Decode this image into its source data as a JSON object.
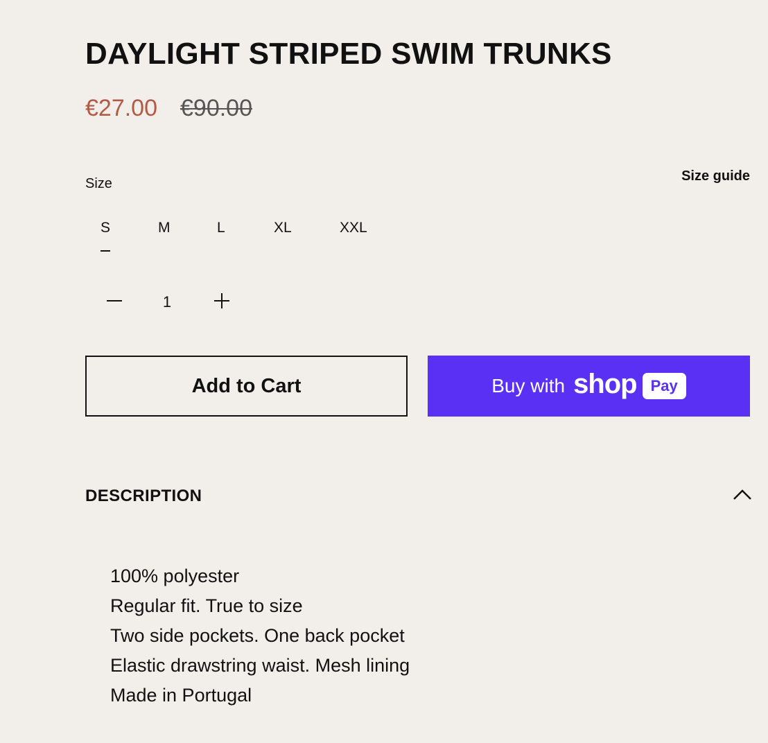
{
  "product": {
    "title": "DAYLIGHT STRIPED SWIM TRUNKS",
    "price": "€27.00",
    "compare_at_price": "€90.00"
  },
  "size": {
    "label": "Size",
    "guide_label": "Size guide",
    "options": [
      "S",
      "M",
      "L",
      "XL",
      "XXL"
    ],
    "selected": "S"
  },
  "quantity": {
    "value": "1",
    "decrement_icon": "minus-icon",
    "increment_icon": "plus-icon"
  },
  "actions": {
    "add_to_cart": "Add to Cart",
    "shop_pay": {
      "prefix": "Buy with",
      "brand": "shop",
      "badge": "Pay"
    }
  },
  "description": {
    "heading": "DESCRIPTION",
    "toggle_icon": "chevron-up-icon",
    "items": [
      "100% polyester",
      "Regular fit. True to size",
      "Two side pockets. One back pocket",
      "Elastic drawstring waist. Mesh lining",
      "Made in Portugal"
    ]
  },
  "colors": {
    "background": "#f2eeea",
    "sale_price": "#b35a45",
    "shop_pay": "#5a31f4",
    "text": "#111111"
  }
}
